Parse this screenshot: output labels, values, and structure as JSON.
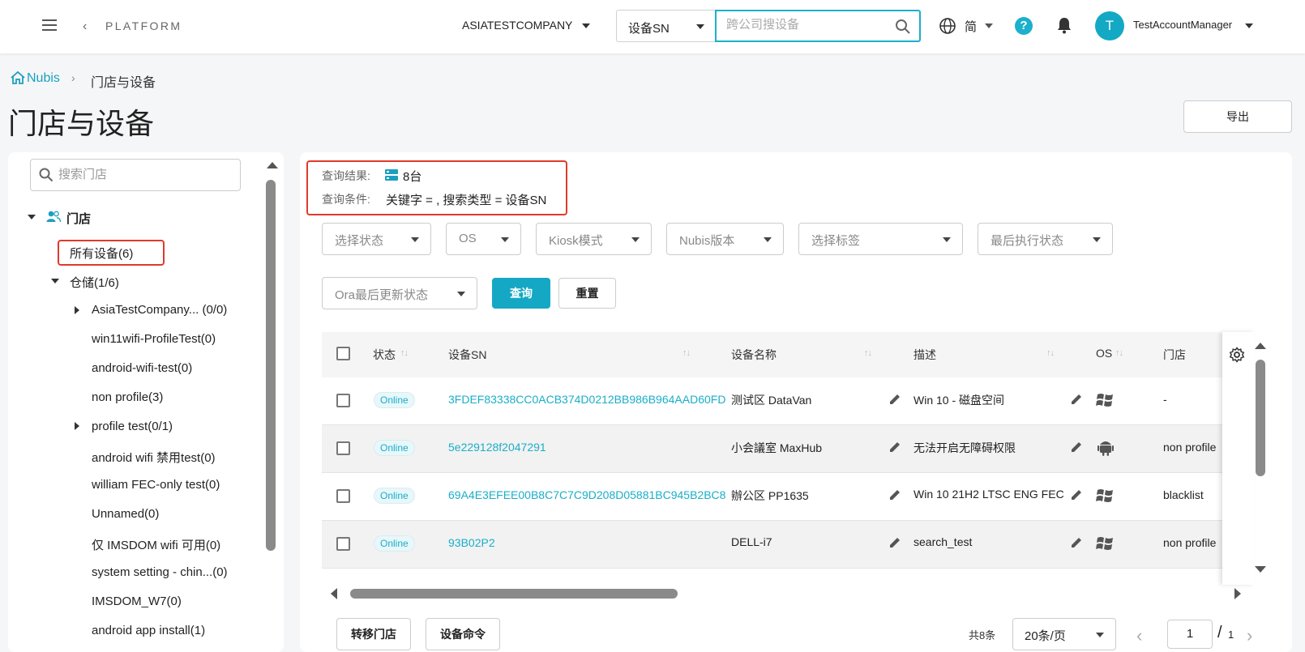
{
  "header": {
    "back_label": "PLATFORM",
    "company": "ASIATESTCOMPANY",
    "search_type": "设备SN",
    "search_placeholder": "跨公司搜设备",
    "language": "简",
    "avatar_initial": "T",
    "username": "TestAccountManager"
  },
  "breadcrumb": {
    "home": "Nubis",
    "current": "门店与设备"
  },
  "page": {
    "title": "门店与设备",
    "export_label": "导出"
  },
  "sidebar": {
    "search_placeholder": "搜索门店",
    "root_label": "门店",
    "all_devices": "所有设备(6)",
    "group_label": "仓储(1/6)",
    "items": [
      {
        "label": "AsiaTestCompany... (0/0)",
        "expandable": true
      },
      {
        "label": "win11wifi-ProfileTest(0)",
        "expandable": false
      },
      {
        "label": "android-wifi-test(0)",
        "expandable": false
      },
      {
        "label": "non profile(3)",
        "expandable": false
      },
      {
        "label": "profile test(0/1)",
        "expandable": true
      },
      {
        "label": "android wifi 禁用test(0)",
        "expandable": false
      },
      {
        "label": "william FEC-only test(0)",
        "expandable": false
      },
      {
        "label": "Unnamed(0)",
        "expandable": false
      },
      {
        "label": "仅 IMSDOM wifi 可用(0)",
        "expandable": false
      },
      {
        "label": "system setting - chin...(0)",
        "expandable": false
      },
      {
        "label": "IMSDOM_W7(0)",
        "expandable": false
      },
      {
        "label": "android app install(1)",
        "expandable": false
      }
    ]
  },
  "result": {
    "result_label": "查询结果:",
    "count": "8台",
    "condition_label": "查询条件:",
    "condition": "关键字 = , 搜索类型 = 设备SN"
  },
  "filters": {
    "status": "选择状态",
    "os": "OS",
    "kiosk": "Kiosk模式",
    "nubis_version": "Nubis版本",
    "tags": "选择标签",
    "last_exec": "最后执行状态",
    "ora_update": "Ora最后更新状态",
    "query_label": "查询",
    "reset_label": "重置"
  },
  "table": {
    "columns": [
      "状态",
      "设备SN",
      "设备名称",
      "描述",
      "OS",
      "门店"
    ],
    "rows": [
      {
        "status": "Online",
        "sn": "3FDEF83338CC0ACB374D0212BB986B964AAD60FD",
        "name": "测试区 DataVan",
        "desc": "Win 10 - 磁盘空间",
        "os": "windows",
        "store": "-"
      },
      {
        "status": "Online",
        "sn": "5e229128f2047291",
        "name": "小会議室 MaxHub",
        "desc": "无法开启无障碍权限",
        "os": "android",
        "store": "non profile"
      },
      {
        "status": "Online",
        "sn": "69A4E3EFEE00B8C7C7C9D208D05881BC945B2BC8",
        "name": "辦公区 PP1635",
        "desc": "Win 10 21H2 LTSC ENG FEC",
        "os": "windows",
        "store": "blacklist"
      },
      {
        "status": "Online",
        "sn": "93B02P2",
        "name": "DELL-i7",
        "desc": "search_test",
        "os": "windows",
        "store": "non profile"
      }
    ]
  },
  "footer": {
    "transfer_label": "转移门店",
    "command_label": "设备命令",
    "total": "共8条",
    "page_size": "20条/页",
    "current_page": "1",
    "slash": "/",
    "total_pages": "1"
  }
}
